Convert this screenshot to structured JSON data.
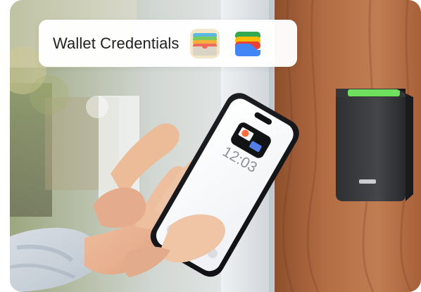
{
  "badge": {
    "title": "Wallet Credentials",
    "icons": [
      "apple-wallet-icon",
      "google-wallet-icon"
    ]
  },
  "phone": {
    "lockscreen_time": "12:03"
  },
  "reader": {
    "led_color": "#6EE05D"
  },
  "colors": {
    "badge_background": "#FFFFFF",
    "title_text": "#1F1F1F",
    "wood": "#B57043",
    "door_frame": "#D9DDE2"
  }
}
